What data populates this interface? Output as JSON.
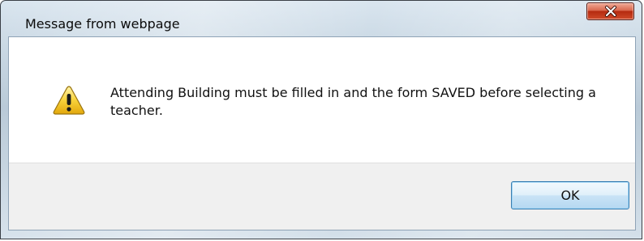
{
  "dialog": {
    "title": "Message from webpage",
    "message": "Attending Building must be filled in and the form SAVED before selecting a teacher.",
    "ok_label": "OK",
    "close_glyph": "X",
    "icon": "warning-icon"
  },
  "colors": {
    "close_button": "#c8452a",
    "ok_button_border": "#3c7fb1",
    "warning_yellow": "#f5c518",
    "button_bar": "#f0f0f0"
  }
}
